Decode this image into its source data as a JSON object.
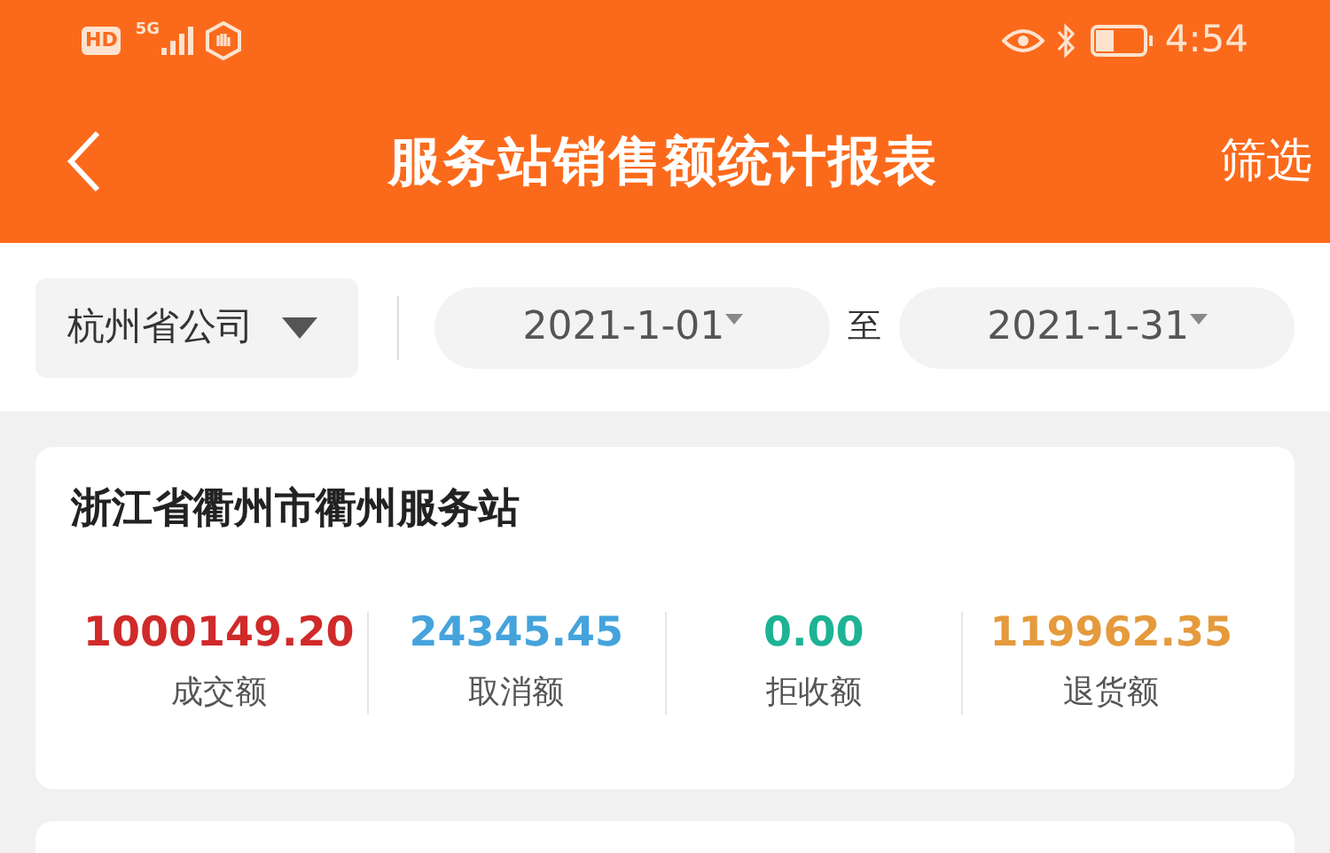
{
  "status_bar": {
    "hd": "HD",
    "network": "5G",
    "time": "4:54"
  },
  "header": {
    "title": "服务站销售额统计报表",
    "filter": "筛选"
  },
  "filters": {
    "company": "杭州省公司",
    "start_date": "2021-1-01",
    "separator": "至",
    "end_date": "2021-1-31"
  },
  "cards": [
    {
      "title": "浙江省衢州市衢州服务站",
      "metrics": [
        {
          "value": "1000149.20",
          "label": "成交额",
          "color": "#d02a2a"
        },
        {
          "value": "24345.45",
          "label": "取消额",
          "color": "#45a3dc"
        },
        {
          "value": "0.00",
          "label": "拒收额",
          "color": "#1db394"
        },
        {
          "value": "119962.35",
          "label": "退货额",
          "color": "#e59a3c"
        }
      ]
    }
  ]
}
